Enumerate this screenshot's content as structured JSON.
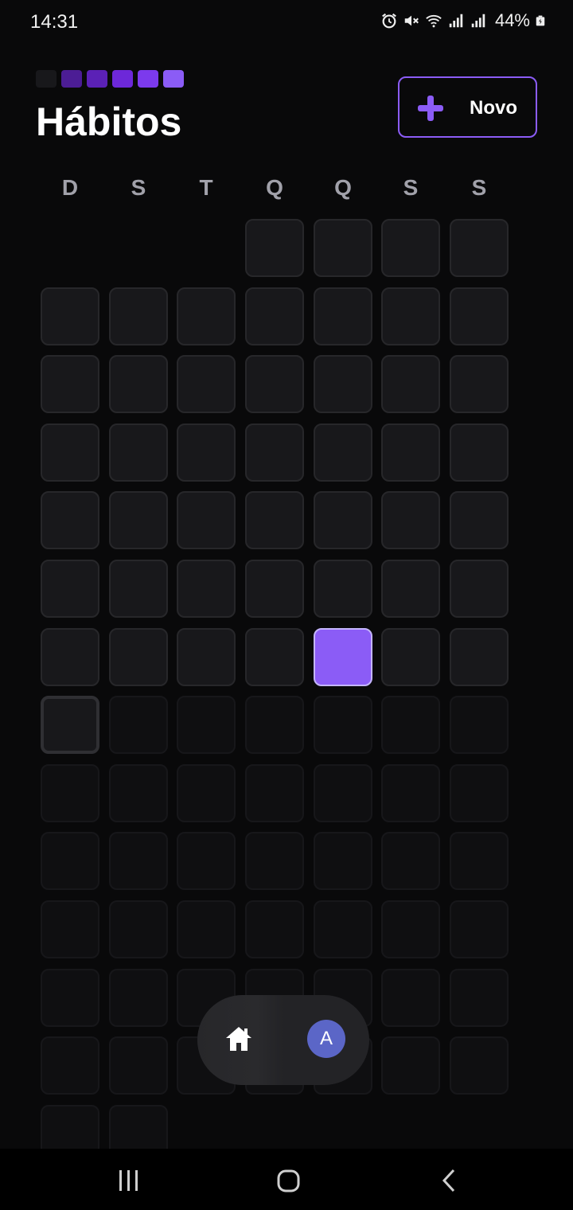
{
  "status_bar": {
    "time": "14:31",
    "battery": "44%",
    "icons": [
      "alarm-icon",
      "mute-icon",
      "wifi-icon",
      "signal-icon",
      "signal-icon",
      "battery-icon"
    ]
  },
  "header": {
    "title": "Hábitos",
    "new_button_label": "Novo",
    "logo_colors": [
      "#18181b",
      "#4c1d95",
      "#5b21b6",
      "#6d28d9",
      "#7c3aed",
      "#8b5cf6"
    ],
    "accent": "#8b5cf6"
  },
  "weekdays": [
    "D",
    "S",
    "T",
    "Q",
    "Q",
    "S",
    "S"
  ],
  "calendar": {
    "leading_empty_days": 3,
    "states": [
      "past",
      "past",
      "past",
      "past",
      "past",
      "past",
      "past",
      "past",
      "past",
      "past",
      "past",
      "past",
      "past",
      "past",
      "past",
      "past",
      "past",
      "past",
      "past",
      "past",
      "past",
      "past",
      "past",
      "past",
      "past",
      "past",
      "past",
      "past",
      "past",
      "past",
      "past",
      "past",
      "past",
      "past",
      "past",
      "past",
      "past",
      "past",
      "past",
      "past",
      "past",
      "past",
      "past",
      "done",
      "past",
      "past",
      "today",
      "future",
      "future",
      "future",
      "future",
      "future",
      "future",
      "future",
      "future",
      "future",
      "future",
      "future",
      "future",
      "future",
      "future",
      "future",
      "future",
      "future",
      "future",
      "future",
      "future",
      "future",
      "future",
      "future",
      "future",
      "future",
      "future",
      "future",
      "future",
      "future",
      "future",
      "future",
      "future",
      "future",
      "future",
      "future",
      "future",
      "future",
      "future",
      "future",
      "future",
      "future",
      "future",
      "future"
    ]
  },
  "bottom_nav": {
    "home_icon": "home-icon",
    "avatar_initial": "A"
  },
  "system_nav": [
    "recents-icon",
    "home-circle-icon",
    "back-icon"
  ]
}
